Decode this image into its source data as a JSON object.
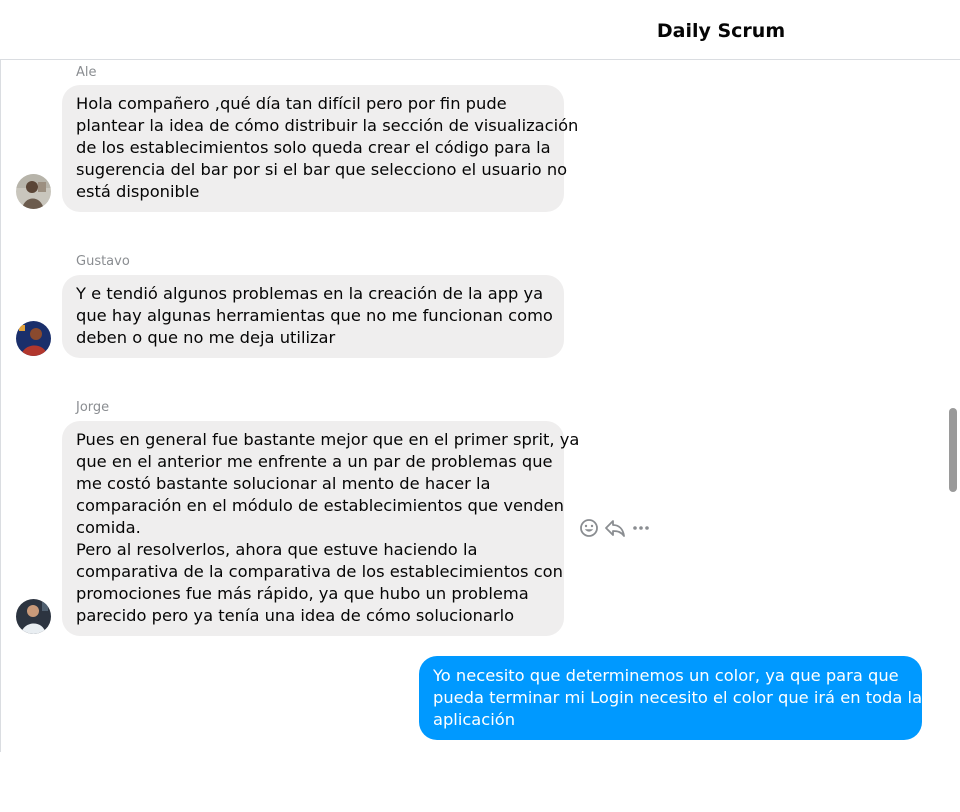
{
  "header": {
    "title": "Daily Scrum"
  },
  "messages": [
    {
      "sender": "Ale",
      "lines": [
        "Hola compañero ,qué día tan difícil pero por fin pude",
        "plantear la idea de cómo distribuir la sección de visualización",
        "de los establecimientos solo queda crear el código para la",
        "sugerencia del bar por si el bar que selecciono el usuario no",
        "está disponible"
      ]
    },
    {
      "sender": "Gustavo",
      "lines": [
        "Y e tendió algunos problemas en la creación de la app ya",
        "que hay algunas herramientas que no me funcionan como",
        "deben o que no me deja utilizar"
      ]
    },
    {
      "sender": "Jorge",
      "lines": [
        "Pues en general fue bastante mejor que en el primer sprit, ya",
        "que en el anterior me enfrente a un par de problemas que",
        "me costó bastante solucionar al mento de hacer la",
        "comparación en el módulo de establecimientos que venden",
        "comida.",
        "Pero al resolverlos, ahora que estuve haciendo la",
        "comparativa de la comparativa de los establecimientos con",
        "promociones fue más rápido, ya que hubo un problema",
        "parecido pero ya tenía una idea de cómo solucionarlo"
      ]
    }
  ],
  "own_message": {
    "lines": [
      "Yo necesito que determinemos un color, ya que para que",
      "pueda terminar mi Login necesito el color que irá en toda la",
      "aplicación"
    ]
  },
  "message_actions": [
    "react-icon",
    "reply-icon",
    "more-icon"
  ],
  "colors": {
    "own_bubble": "#0099ff",
    "other_bubble": "#efeeee",
    "sender_name": "#8a8d91"
  }
}
